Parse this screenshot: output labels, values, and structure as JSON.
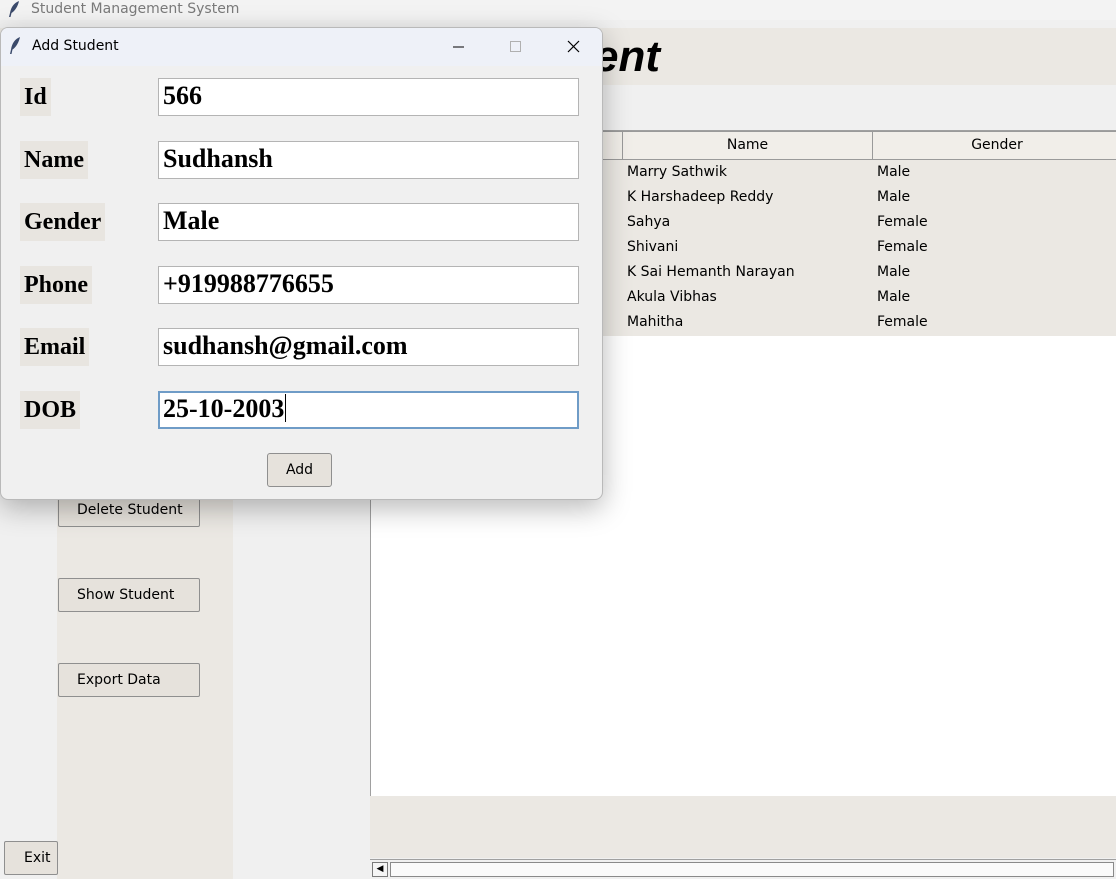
{
  "window": {
    "title": "Student Management System"
  },
  "header": {
    "title_fragment": "ent"
  },
  "sidebar": {
    "delete_label": "Delete Student",
    "show_label": "Show Student",
    "export_label": "Export Data",
    "exit_label": "Exit"
  },
  "table": {
    "columns": [
      "Name",
      "Gender"
    ],
    "rows": [
      {
        "name": "Marry Sathwik",
        "gender": "Male"
      },
      {
        "name": "K Harshadeep Reddy",
        "gender": "Male"
      },
      {
        "name": "Sahya",
        "gender": "Female"
      },
      {
        "name": "Shivani",
        "gender": "Female"
      },
      {
        "name": "K Sai Hemanth Narayan",
        "gender": "Male"
      },
      {
        "name": "Akula Vibhas",
        "gender": "Male"
      },
      {
        "name": "Mahitha",
        "gender": "Female"
      }
    ]
  },
  "dialog": {
    "title": "Add Student",
    "fields": [
      {
        "label": "Id",
        "value": "566"
      },
      {
        "label": "Name",
        "value": "Sudhansh"
      },
      {
        "label": "Gender",
        "value": "Male"
      },
      {
        "label": "Phone",
        "value": "+919988776655"
      },
      {
        "label": "Email",
        "value": "sudhansh@gmail.com"
      },
      {
        "label": "DOB",
        "value": "25-10-2003"
      }
    ],
    "add_label": "Add"
  }
}
